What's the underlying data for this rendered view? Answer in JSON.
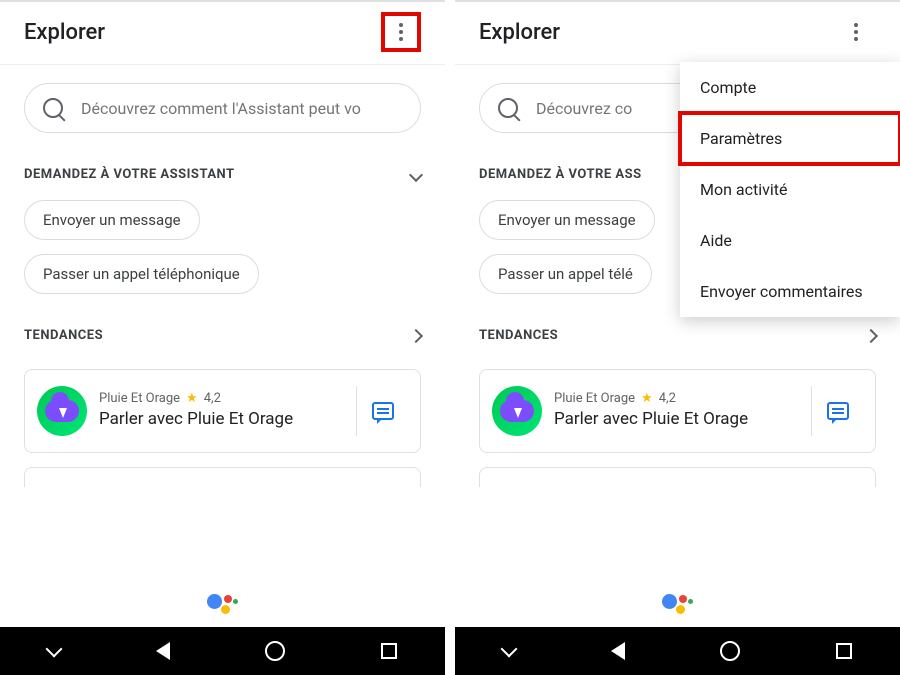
{
  "left": {
    "header": {
      "title": "Explorer"
    },
    "search": {
      "placeholder": "Découvrez comment l'Assistant peut vo"
    },
    "ask_section": {
      "label": "DEMANDEZ À VOTRE ASSISTANT"
    },
    "chips": [
      "Envoyer un message",
      "Passer un appel téléphonique"
    ],
    "trends_section": {
      "label": "TENDANCES"
    },
    "trend_card": {
      "provider": "Pluie Et Orage",
      "rating": "4,2",
      "title": "Parler avec Pluie Et Orage"
    }
  },
  "right": {
    "header": {
      "title": "Explorer"
    },
    "search": {
      "placeholder": "Découvrez co"
    },
    "ask_section": {
      "label": "DEMANDEZ À VOTRE ASS"
    },
    "chips": [
      "Envoyer un message",
      "Passer un appel télé"
    ],
    "trends_section": {
      "label": "TENDANCES"
    },
    "trend_card": {
      "provider": "Pluie Et Orage",
      "rating": "4,2",
      "title": "Parler avec Pluie Et Orage"
    },
    "menu": {
      "items": [
        "Compte",
        "Paramètres",
        "Mon activité",
        "Aide",
        "Envoyer commentaires"
      ]
    }
  }
}
